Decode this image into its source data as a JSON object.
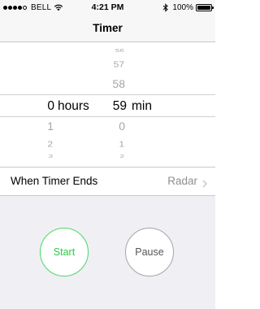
{
  "status_bar": {
    "carrier": "BELL",
    "time": "4:21 PM",
    "battery_percent": "100%",
    "battery_level": 1.0,
    "signal_bars_filled": 4,
    "signal_bars_total": 5,
    "icons": [
      "wifi-icon",
      "bluetooth-icon",
      "battery-icon"
    ]
  },
  "nav": {
    "title": "Timer"
  },
  "picker": {
    "hours": {
      "above": [],
      "selected": "0",
      "unit": "hours",
      "below": [
        "1",
        "2",
        "3"
      ]
    },
    "minutes": {
      "above": [
        "56",
        "57",
        "58"
      ],
      "selected": "59",
      "unit": "min",
      "below": [
        "0",
        "1",
        "2"
      ]
    }
  },
  "when_timer_ends": {
    "label": "When Timer Ends",
    "value": "Radar",
    "icon": "chevron-right-icon"
  },
  "buttons": {
    "start": "Start",
    "pause": "Pause"
  },
  "colors": {
    "start_accent": "#4cd964",
    "pause_border": "#a5a5aa",
    "background": "#efeff4",
    "secondary_text": "#8e8e93"
  }
}
